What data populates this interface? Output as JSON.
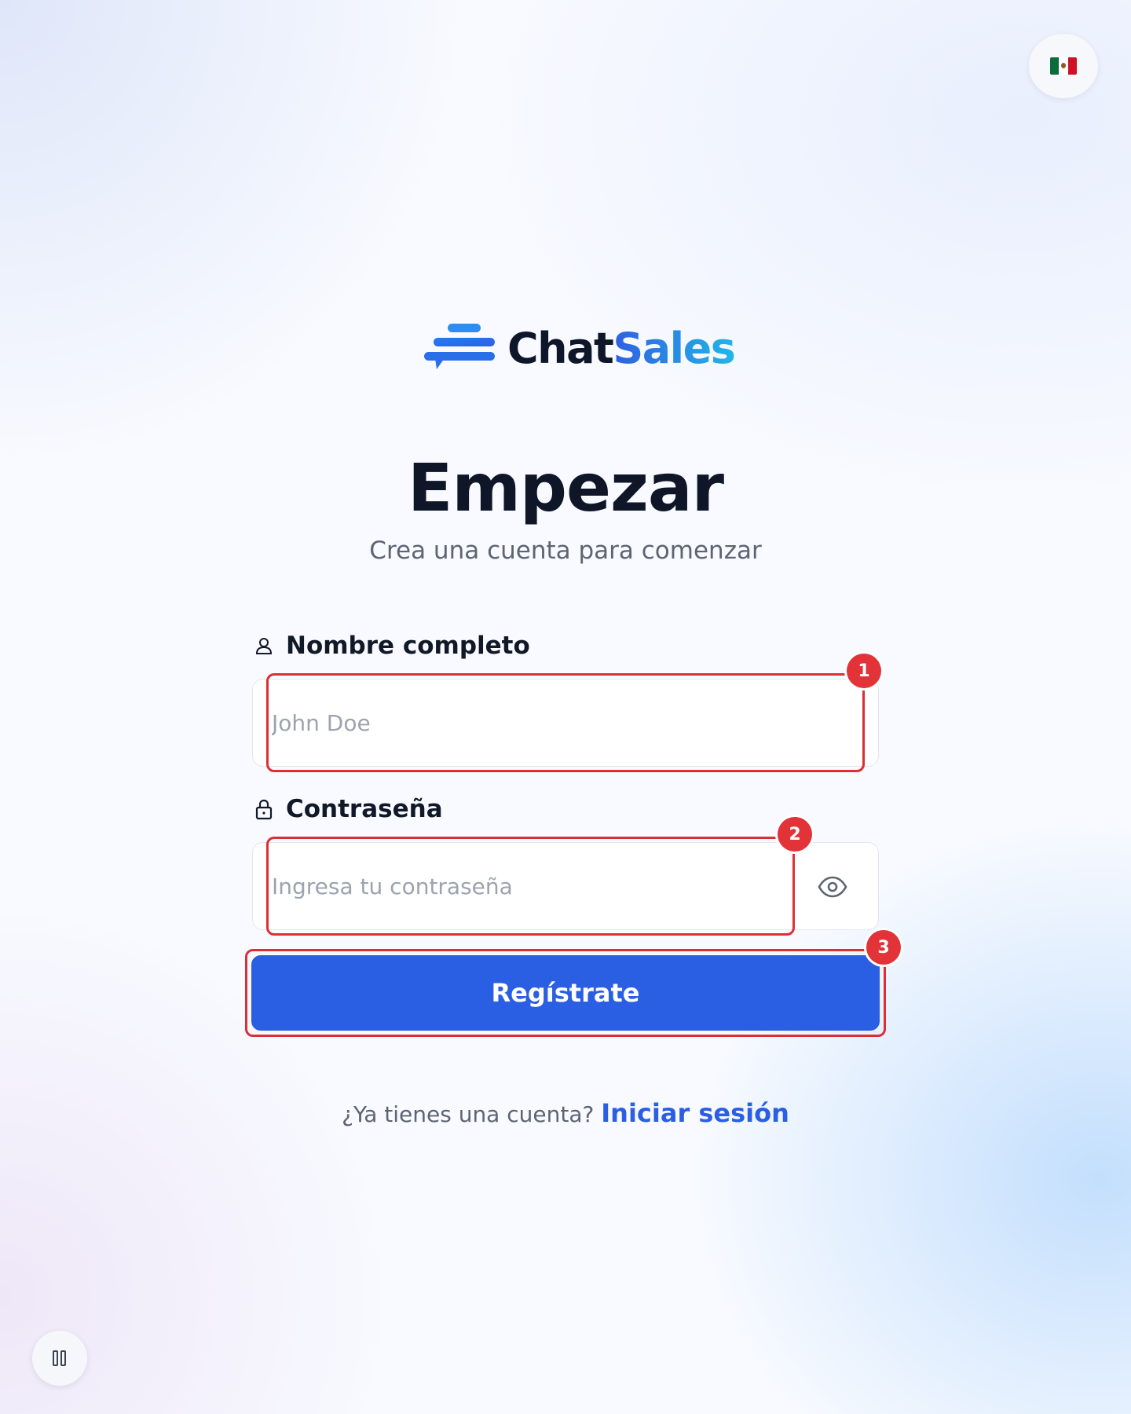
{
  "language": {
    "flag_name": "mexico-flag-icon"
  },
  "brand": {
    "name_part1": "Chat",
    "name_part2": "Sales",
    "gradient": [
      "#2f5fe0",
      "#22b6e8"
    ]
  },
  "heading": {
    "title": "Empezar",
    "subtitle": "Crea una cuenta para comenzar"
  },
  "form": {
    "name_field": {
      "label": "Nombre completo",
      "placeholder": "John Doe",
      "value": ""
    },
    "password_field": {
      "label": "Contraseña",
      "placeholder": "Ingresa tu contraseña",
      "value": ""
    },
    "submit_label": "Regístrate"
  },
  "footer": {
    "prompt": "¿Ya tienes una cuenta?",
    "link": "Iniciar sesión"
  },
  "annotations": [
    {
      "number": "1",
      "target": "name-input"
    },
    {
      "number": "2",
      "target": "password-input"
    },
    {
      "number": "3",
      "target": "register-button"
    }
  ],
  "colors": {
    "accent": "#2a5ee3",
    "highlight": "#dc2f35",
    "heading": "#0f1628",
    "muted": "#5d6472"
  }
}
